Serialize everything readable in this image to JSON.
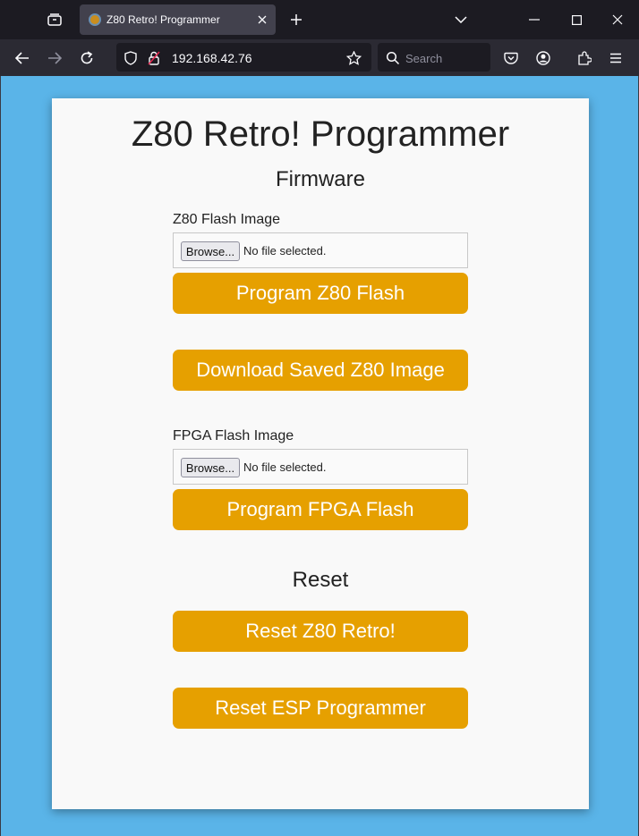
{
  "browser": {
    "tab_title": "Z80 Retro! Programmer",
    "url": "192.168.42.76",
    "search_placeholder": "Search"
  },
  "page": {
    "title": "Z80 Retro! Programmer",
    "firmware_heading": "Firmware",
    "z80_section": {
      "label": "Z80 Flash Image",
      "browse_label": "Browse...",
      "file_status": "No file selected.",
      "program_button": "Program Z80 Flash"
    },
    "download_button": "Download Saved Z80 Image",
    "fpga_section": {
      "label": "FPGA Flash Image",
      "browse_label": "Browse...",
      "file_status": "No file selected.",
      "program_button": "Program FPGA Flash"
    },
    "reset_heading": "Reset",
    "reset_z80_button": "Reset Z80 Retro!",
    "reset_esp_button": "Reset ESP Programmer"
  },
  "colors": {
    "accent": "#e6a000",
    "background": "#5ab4e8",
    "card": "#f9f9f9"
  }
}
